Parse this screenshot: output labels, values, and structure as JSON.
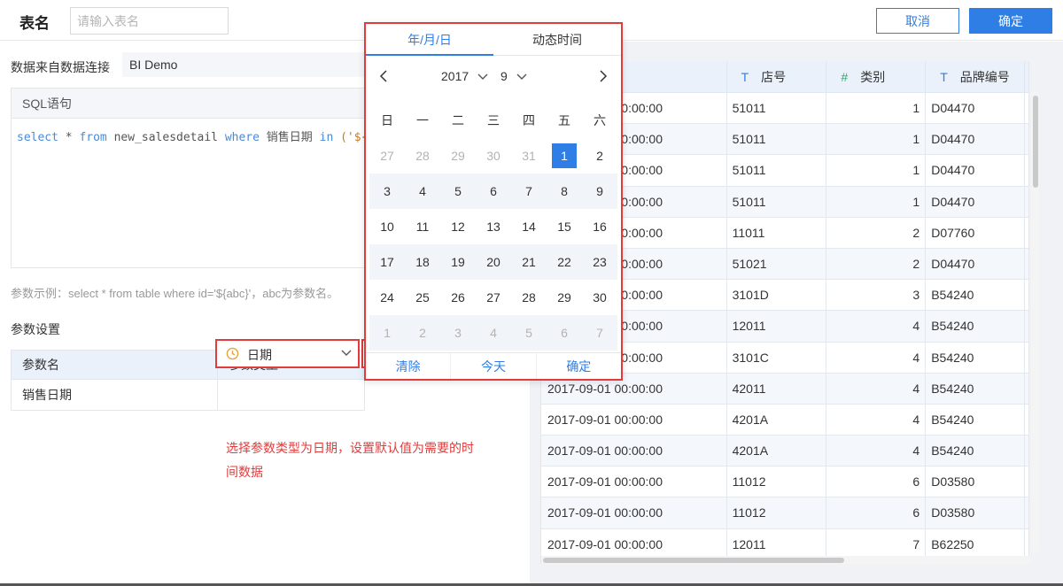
{
  "header": {
    "table_name_label": "表名",
    "table_name_placeholder": "请输入表名",
    "cancel_label": "取消",
    "confirm_label": "确定"
  },
  "connection": {
    "label": "数据来自数据连接",
    "value": "BI Demo"
  },
  "sql": {
    "title": "SQL语句",
    "kw_select": "select",
    "star": " * ",
    "kw_from": "from",
    "table": " new_salesdetail ",
    "kw_where": "where",
    "field": " 销售日期 ",
    "kw_in": "in",
    "tail": " ('${销售"
  },
  "param_example": "参数示例：select * from table where id='${abc}'，abc为参数名。",
  "param_settings": {
    "title": "参数设置",
    "col_name": "参数名",
    "col_type": "参数类型",
    "rows": [
      {
        "name": "销售日期",
        "type": "日期",
        "default": "2017-09-01"
      }
    ]
  },
  "annotation": "选择参数类型为日期，设置默认值为需要的时间数据",
  "picker": {
    "tab_date": "年/月/日",
    "tab_dynamic": "动态时间",
    "year": "2017",
    "month": "9",
    "weekdays": [
      "日",
      "一",
      "二",
      "三",
      "四",
      "五",
      "六"
    ],
    "weeks": [
      [
        {
          "d": "27",
          "m": true
        },
        {
          "d": "28",
          "m": true
        },
        {
          "d": "29",
          "m": true
        },
        {
          "d": "30",
          "m": true
        },
        {
          "d": "31",
          "m": true
        },
        {
          "d": "1",
          "s": true
        },
        {
          "d": "2"
        }
      ],
      [
        {
          "d": "3"
        },
        {
          "d": "4"
        },
        {
          "d": "5"
        },
        {
          "d": "6"
        },
        {
          "d": "7"
        },
        {
          "d": "8"
        },
        {
          "d": "9"
        }
      ],
      [
        {
          "d": "10"
        },
        {
          "d": "11"
        },
        {
          "d": "12"
        },
        {
          "d": "13"
        },
        {
          "d": "14"
        },
        {
          "d": "15"
        },
        {
          "d": "16"
        }
      ],
      [
        {
          "d": "17"
        },
        {
          "d": "18"
        },
        {
          "d": "19"
        },
        {
          "d": "20"
        },
        {
          "d": "21"
        },
        {
          "d": "22"
        },
        {
          "d": "23"
        }
      ],
      [
        {
          "d": "24"
        },
        {
          "d": "25"
        },
        {
          "d": "26"
        },
        {
          "d": "27"
        },
        {
          "d": "28"
        },
        {
          "d": "29"
        },
        {
          "d": "30"
        }
      ],
      [
        {
          "d": "1",
          "m": true
        },
        {
          "d": "2",
          "m": true
        },
        {
          "d": "3",
          "m": true
        },
        {
          "d": "4",
          "m": true
        },
        {
          "d": "5",
          "m": true
        },
        {
          "d": "6",
          "m": true
        },
        {
          "d": "7",
          "m": true
        }
      ]
    ],
    "clear_label": "清除",
    "today_label": "今天",
    "confirm_label": "确定"
  },
  "data_table": {
    "headers": [
      {
        "icon": "",
        "label": "期"
      },
      {
        "icon": "T",
        "label": "店号"
      },
      {
        "icon": "#",
        "label": "类别"
      },
      {
        "icon": "T",
        "label": "品牌编号"
      }
    ],
    "rows": [
      [
        "2017-09-01 00:00:00",
        "51011",
        "1",
        "D04470"
      ],
      [
        "2017-09-01 00:00:00",
        "51011",
        "1",
        "D04470"
      ],
      [
        "2017-09-01 00:00:00",
        "51011",
        "1",
        "D04470"
      ],
      [
        "2017-09-01 00:00:00",
        "51011",
        "1",
        "D04470"
      ],
      [
        "2017-09-01 00:00:00",
        "11011",
        "2",
        "D07760"
      ],
      [
        "2017-09-01 00:00:00",
        "51021",
        "2",
        "D04470"
      ],
      [
        "2017-09-01 00:00:00",
        "3101D",
        "3",
        "B54240"
      ],
      [
        "2017-09-01 00:00:00",
        "12011",
        "4",
        "B54240"
      ],
      [
        "2017-09-01 00:00:00",
        "3101C",
        "4",
        "B54240"
      ],
      [
        "2017-09-01 00:00:00",
        "42011",
        "4",
        "B54240"
      ],
      [
        "2017-09-01 00:00:00",
        "4201A",
        "4",
        "B54240"
      ],
      [
        "2017-09-01 00:00:00",
        "4201A",
        "4",
        "B54240"
      ],
      [
        "2017-09-01 00:00:00",
        "11012",
        "6",
        "D03580"
      ],
      [
        "2017-09-01 00:00:00",
        "11012",
        "6",
        "D03580"
      ],
      [
        "2017-09-01 00:00:00",
        "12011",
        "7",
        "B62250"
      ],
      [
        "2017-09-01 00:00:00",
        "12011",
        "7",
        "B62250"
      ]
    ]
  },
  "colors": {
    "accent": "#2f7ee5",
    "highlight_border": "#e23b3b",
    "number_type": "#33a86b"
  }
}
